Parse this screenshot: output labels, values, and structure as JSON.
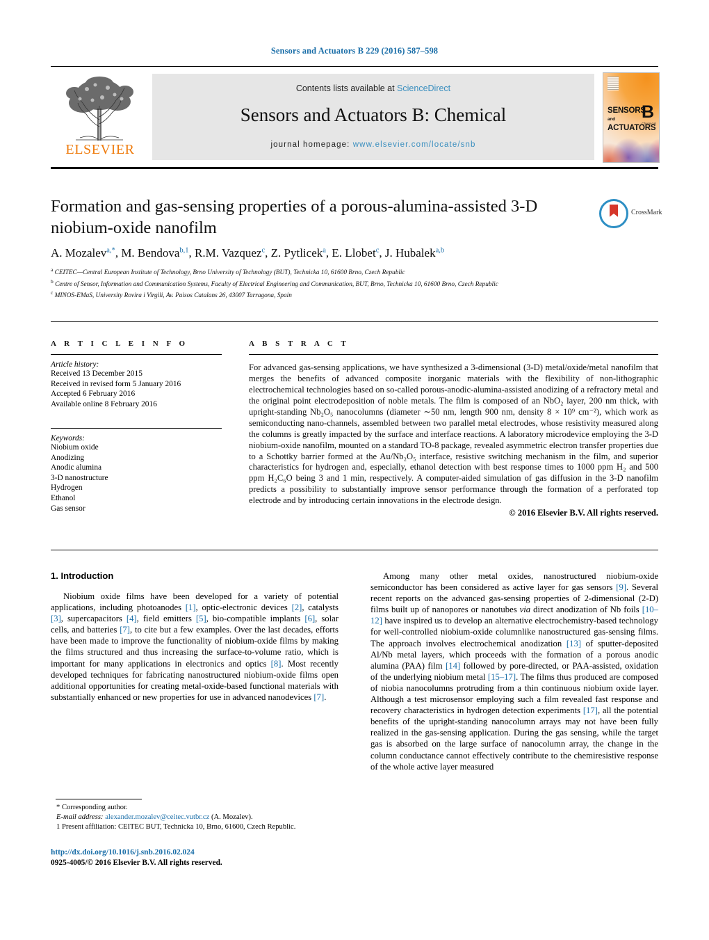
{
  "running_head": "Sensors and Actuators B 229 (2016) 587–598",
  "masthead": {
    "contents_prefix": "Contents lists available at ",
    "contents_link": "ScienceDirect",
    "journal_title": "Sensors and Actuators B: Chemical",
    "homepage_prefix": "journal homepage: ",
    "homepage_url": "www.elsevier.com/locate/snb",
    "publisher": "ELSEVIER",
    "cover": {
      "line1": "SENSORS",
      "and": "and",
      "line2": "ACTUATORS",
      "letter": "B",
      "sub": "Chemical"
    }
  },
  "article": {
    "title": "Formation and gas-sensing properties of a porous-alumina-assisted 3-D niobium-oxide nanofilm",
    "crossmark_label": "CrossMark",
    "authors_html": "A. Mozalev<sup>a,*</sup>, M. Bendova<sup>b,1</sup>, R.M. Vazquez<sup>c</sup>, Z. Pytlicek<sup>a</sup>, E. Llobet<sup>c</sup>, J. Hubalek<sup>a,b</sup>",
    "affiliations": [
      "CEITEC—Central European Institute of Technology, Brno University of Technology (BUT), Technicka 10, 61600 Brno, Czech Republic",
      "Centre of Sensor, Information and Communication Systems, Faculty of Electrical Engineering and Communication, BUT, Brno, Technicka 10, 61600 Brno, Czech Republic",
      "MINOS-EMaS, University Rovira i Virgili, Av. Paisos Catalans 26, 43007 Tarragona, Spain"
    ],
    "affiliation_marks": [
      "a",
      "b",
      "c"
    ]
  },
  "article_info": {
    "heading": "A R T I C L E   I N F O",
    "history_label": "Article history:",
    "history": [
      "Received 13 December 2015",
      "Received in revised form 5 January 2016",
      "Accepted 6 February 2016",
      "Available online 8 February 2016"
    ],
    "keywords_label": "Keywords:",
    "keywords": [
      "Niobium oxide",
      "Anodizing",
      "Anodic alumina",
      "3-D nanostructure",
      "Hydrogen",
      "Ethanol",
      "Gas sensor"
    ]
  },
  "abstract": {
    "heading": "A B S T R A C T",
    "text": "For advanced gas-sensing applications, we have synthesized a 3-dimensional (3-D) metal/oxide/metal nanofilm that merges the benefits of advanced composite inorganic materials with the flexibility of non-lithographic electrochemical technologies based on so-called porous-anodic-alumina-assisted anodizing of a refractory metal and the original point electrodeposition of noble metals. The film is composed of an NbO₂ layer, 200 nm thick, with upright-standing Nb₂O₅ nanocolumns (diameter ∼50 nm, length 900 nm, density 8 × 10⁹ cm⁻²), which work as semiconducting nano-channels, assembled between two parallel metal electrodes, whose resistivity measured along the columns is greatly impacted by the surface and interface reactions. A laboratory microdevice employing the 3-D niobium-oxide nanofilm, mounted on a standard TO-8 package, revealed asymmetric electron transfer properties due to a Schottky barrier formed at the Au/Nb₂O₅ interface, resistive switching mechanism in the film, and superior characteristics for hydrogen and, especially, ethanol detection with best response times to 1000 ppm H₂ and 500 ppm H₂C₆O being 3 and 1 min, respectively. A computer-aided simulation of gas diffusion in the 3-D nanofilm predicts a possibility to substantially improve sensor performance through the formation of a perforated top electrode and by introducing certain innovations in the electrode design.",
    "copyright": "© 2016 Elsevier B.V. All rights reserved."
  },
  "body": {
    "section_heading": "1.  Introduction",
    "left_paragraph_1": "Niobium oxide films have been developed for a variety of potential applications, including photoanodes [1], optic-electronic devices [2], catalysts [3], supercapacitors [4], field emitters [5], bio-compatible implants [6], solar cells, and batteries [7], to cite but a few examples. Over the last decades, efforts have been made to improve the functionality of niobium-oxide films by making the films structured and thus increasing the surface-to-volume ratio, which is important for many applications in electronics and optics [8]. Most recently developed techniques for fabricating nanostructured niobium-oxide films open additional opportunities for creating metal-oxide-based functional materials with substantially enhanced or new properties for use in advanced nanodevices [7].",
    "right_paragraph_1": "Among many other metal oxides, nanostructured niobium-oxide semiconductor has been considered as active layer for gas sensors [9]. Several recent reports on the advanced gas-sensing properties of 2-dimensional (2-D) films built up of nanopores or nanotubes via direct anodization of Nb foils [10–12] have inspired us to develop an alternative electrochemistry-based technology for well-controlled niobium-oxide columnlike nanostructured gas-sensing films. The approach involves electrochemical anodization [13] of sputter-deposited Al/Nb metal layers, which proceeds with the formation of a porous anodic alumina (PAA) film [14] followed by pore-directed, or PAA-assisted, oxidation of the underlying niobium metal [15–17]. The films thus produced are composed of niobia nanocolumns protruding from a thin continuous niobium oxide layer. Although a test microsensor employing such a film revealed fast response and recovery characteristics in hydrogen detection experiments [17], all the potential benefits of the upright-standing nanocolumn arrays may not have been fully realized in the gas-sensing application. During the gas sensing, while the target gas is absorbed on the large surface of nanocolumn array, the change in the column conductance cannot effectively contribute to the chemiresistive response of the whole active layer measured"
  },
  "footnotes": {
    "corresponding": "* Corresponding author.",
    "email_label": "E-mail address:",
    "email": "alexander.mozalev@ceitec.vutbr.cz",
    "email_suffix": "(A. Mozalev).",
    "present_affiliation": "1  Present affiliation: CEITEC BUT, Technicka 10, Brno, 61600, Czech Republic."
  },
  "footer": {
    "doi": "http://dx.doi.org/10.1016/j.snb.2016.02.024",
    "issn_line": "0925-4005/© 2016 Elsevier B.V. All rights reserved."
  },
  "colors": {
    "link": "#1a6ea8",
    "sciencedirect": "#3b8fbf",
    "elsevier_orange": "#ef7d10",
    "masthead_bg": "#e6e6e6"
  }
}
